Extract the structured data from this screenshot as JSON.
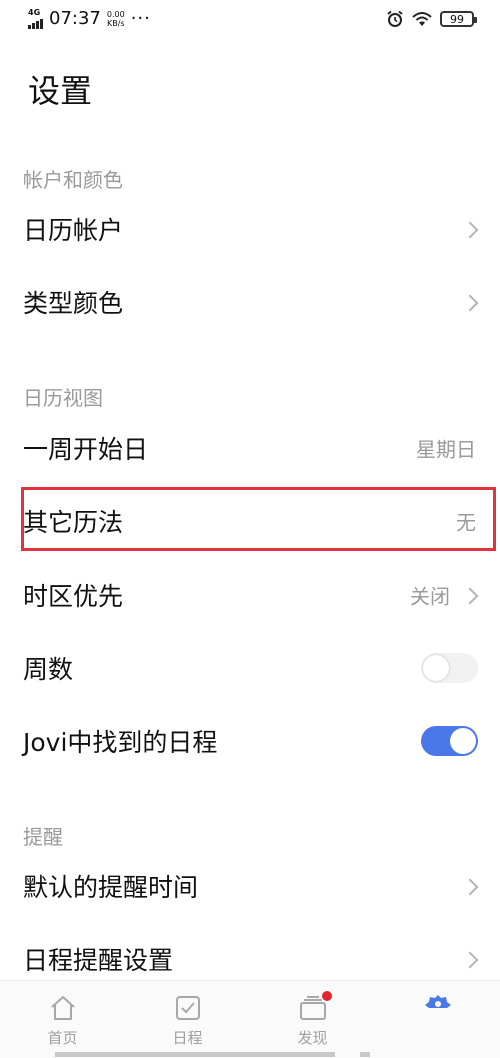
{
  "status": {
    "network": "4G",
    "time": "07:37",
    "speed_value": "0.00",
    "speed_unit": "KB/s",
    "more": "···",
    "battery": "99"
  },
  "title": "设置",
  "sections": {
    "account": "帐户和颜色",
    "view": "日历视图",
    "reminder": "提醒"
  },
  "items": {
    "calendar_account": "日历帐户",
    "type_color": "类型颜色",
    "week_start": {
      "label": "一周开始日",
      "value": "星期日"
    },
    "other_calendar": {
      "label": "其它历法",
      "value": "无"
    },
    "timezone": {
      "label": "时区优先",
      "value": "关闭"
    },
    "week_number": {
      "label": "周数",
      "enabled": false
    },
    "jovi": {
      "label": "Jovi中找到的日程",
      "enabled": true
    },
    "default_reminder": "默认的提醒时间",
    "reminder_settings": "日程提醒设置"
  },
  "tabs": [
    {
      "label": "首页",
      "icon": "home-icon"
    },
    {
      "label": "日程",
      "icon": "checkbox-icon"
    },
    {
      "label": "发现",
      "icon": "cards-icon",
      "badge": true
    },
    {
      "label": "",
      "icon": "settings-gear-icon",
      "active": true
    }
  ],
  "colors": {
    "accent": "#4a78e8",
    "highlight": "#e2333a",
    "badge": "#e0262c"
  }
}
